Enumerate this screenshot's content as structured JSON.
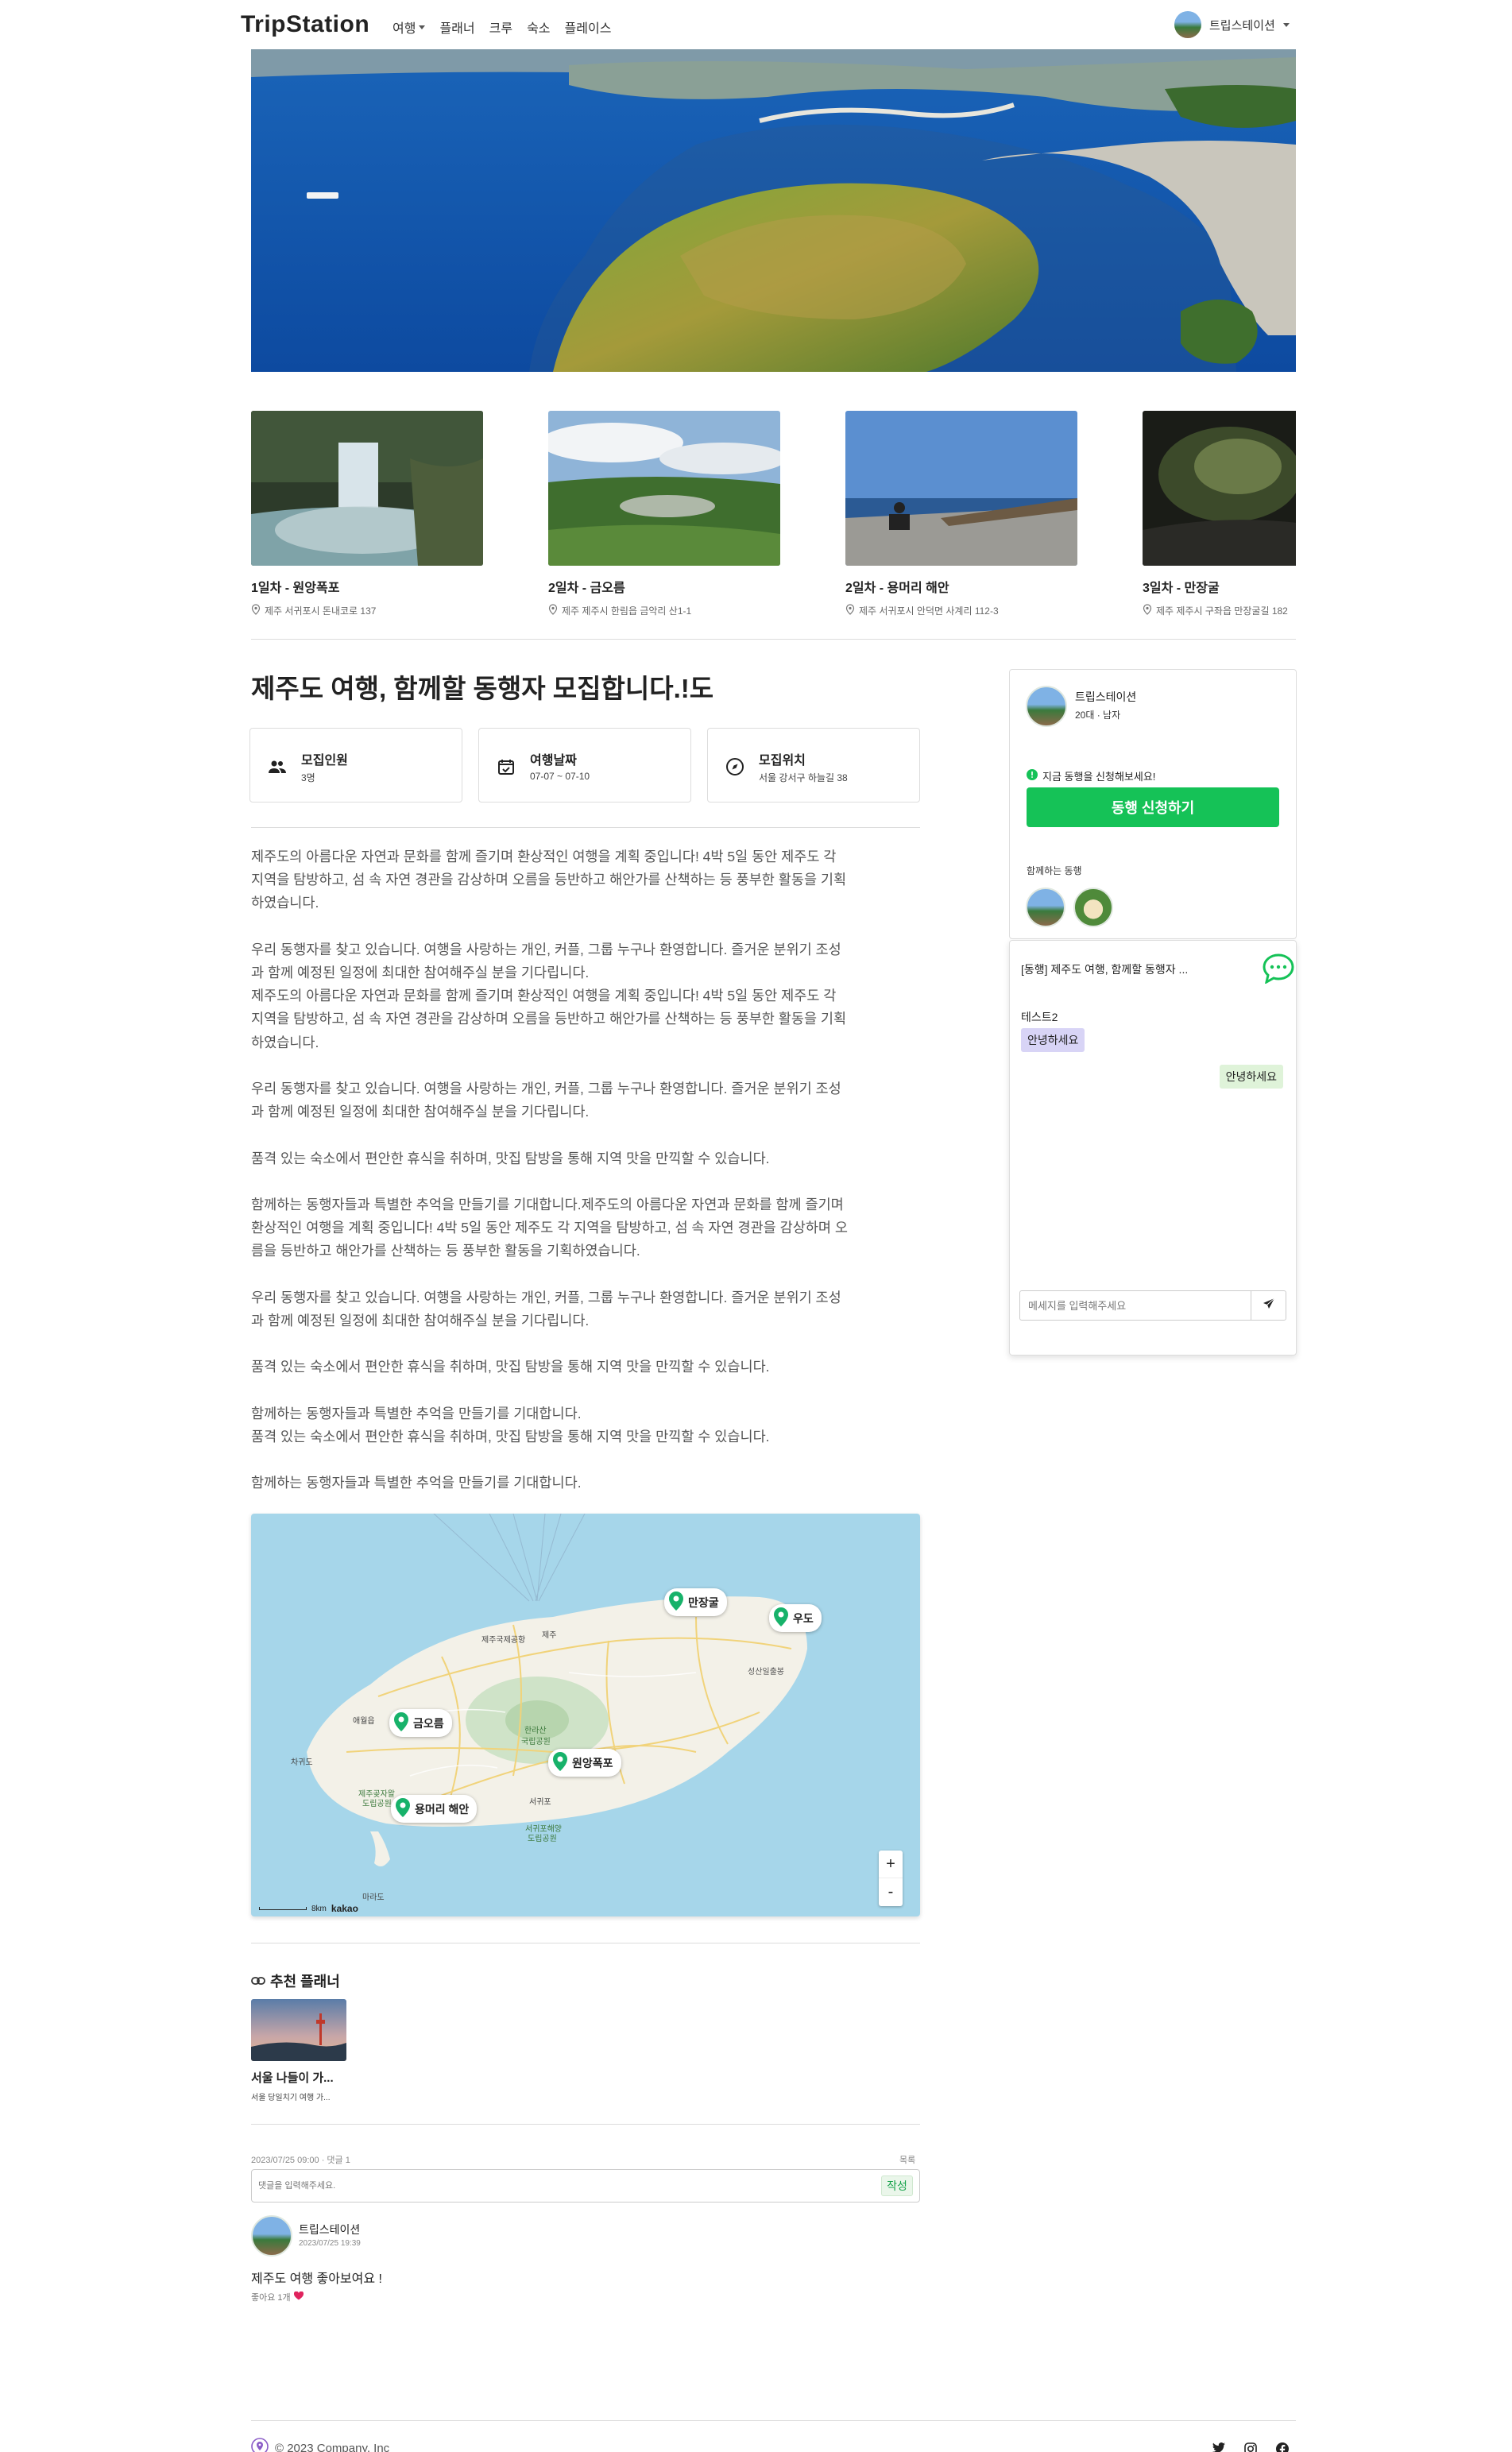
{
  "nav": {
    "logo": "TripStation",
    "menu": [
      {
        "label": "여행",
        "has_dropdown": true
      },
      {
        "label": "플래너",
        "has_dropdown": false
      },
      {
        "label": "크루",
        "has_dropdown": false
      },
      {
        "label": "숙소",
        "has_dropdown": false
      },
      {
        "label": "플레이스",
        "has_dropdown": false
      }
    ],
    "user_name": "트립스테이션"
  },
  "places": [
    {
      "title": "1일차 - 원앙폭포",
      "address": "제주 서귀포시 돈내코로 137"
    },
    {
      "title": "2일차 - 금오름",
      "address": "제주 제주시 한림읍 금악리 산1-1"
    },
    {
      "title": "2일차 - 용머리 해안",
      "address": "제주 서귀포시 안덕면 사계리 112-3"
    },
    {
      "title": "3일차 - 만장굴",
      "address": "제주 제주시 구좌읍 만장굴길 182"
    }
  ],
  "post": {
    "title": "제주도 여행, 함께할 동행자 모집합니다.!도",
    "info": [
      {
        "label": "모집인원",
        "value": "3명",
        "icon": "people-icon"
      },
      {
        "label": "여행날짜",
        "value": "07-07 ~ 07-10",
        "icon": "calendar-check-icon"
      },
      {
        "label": "모집위치",
        "value": "서울 강서구 하늘길 38",
        "icon": "compass-icon"
      }
    ],
    "paragraphs": [
      [
        "제주도의 아름다운 자연과 문화를 함께 즐기며 환상적인 여행을 계획 중입니다! 4박 5일 동안 제주도 각",
        "지역을 탐방하고, 섬 속 자연 경관을 감상하며 오름을 등반하고 해안가를 산책하는 등 풍부한 활동을 기획",
        "하였습니다."
      ],
      [
        "우리 동행자를 찾고 있습니다. 여행을 사랑하는 개인, 커플, 그룹 누구나 환영합니다. 즐거운 분위기 조성",
        "과 함께 예정된 일정에 최대한 참여해주실 분을 기다립니다.",
        "제주도의 아름다운 자연과 문화를 함께 즐기며 환상적인 여행을 계획 중입니다! 4박 5일 동안 제주도 각",
        "지역을 탐방하고, 섬 속 자연 경관을 감상하며 오름을 등반하고 해안가를 산책하는 등 풍부한 활동을 기획",
        "하였습니다."
      ],
      [
        "우리 동행자를 찾고 있습니다. 여행을 사랑하는 개인, 커플, 그룹 누구나 환영합니다. 즐거운 분위기 조성",
        "과 함께 예정된 일정에 최대한 참여해주실 분을 기다립니다."
      ],
      [
        "품격 있는 숙소에서 편안한 휴식을 취하며, 맛집 탐방을 통해 지역 맛을 만끽할 수 있습니다."
      ],
      [
        "함께하는 동행자들과 특별한 추억을 만들기를 기대합니다.제주도의 아름다운 자연과 문화를 함께 즐기며",
        "환상적인 여행을 계획 중입니다! 4박 5일 동안 제주도 각 지역을 탐방하고, 섬 속 자연 경관을 감상하며 오",
        "름을 등반하고 해안가를 산책하는 등 풍부한 활동을 기획하였습니다."
      ],
      [
        "우리 동행자를 찾고 있습니다. 여행을 사랑하는 개인, 커플, 그룹 누구나 환영합니다. 즐거운 분위기 조성",
        "과 함께 예정된 일정에 최대한 참여해주실 분을 기다립니다."
      ],
      [
        "품격 있는 숙소에서 편안한 휴식을 취하며, 맛집 탐방을 통해 지역 맛을 만끽할 수 있습니다."
      ],
      [
        "함께하는 동행자들과 특별한 추억을 만들기를 기대합니다.",
        "품격 있는 숙소에서 편안한 휴식을 취하며, 맛집 탐방을 통해 지역 맛을 만끽할 수 있습니다."
      ],
      [
        "함께하는 동행자들과 특별한 추억을 만들기를 기대합니다."
      ]
    ]
  },
  "map": {
    "markers": [
      "만장굴",
      "우도",
      "금오름",
      "원앙폭포",
      "용머리 해안"
    ],
    "labels": [
      "제주국제공항",
      "제주",
      "성산일출봉",
      "한라산",
      "국립공원",
      "서귀포",
      "서귀포해양",
      "도립공원",
      "제주곶자왈",
      "도립공원",
      "애월읍",
      "차귀도",
      "마라도"
    ],
    "scale_label": "8km",
    "brand": "kakao",
    "zoom_in": "+",
    "zoom_out": "-"
  },
  "recommend": {
    "heading": "추천 플래너",
    "items": [
      {
        "title": "서울 나들이 가...",
        "subtitle": "서울 당일치기 여행 가..."
      }
    ]
  },
  "comments": {
    "meta": "2023/07/25 09:00 · 댓글 1",
    "list_link": "목록",
    "placeholder": "댓글을 입력해주세요.",
    "submit": "작성",
    "items": [
      {
        "author": "트립스테이션",
        "date": "2023/07/25 19:39",
        "text": "제주도 여행 좋아보여요 !",
        "likes": "좋아요 1개"
      }
    ]
  },
  "host": {
    "name": "트립스테이션",
    "meta": "20대 · 남자",
    "notice": "지금 동행을 신청해보세요!",
    "apply_button": "동행 신청하기",
    "companions_label": "함께하는 동행"
  },
  "chat": {
    "title": "[동행] 제주도 여행, 함께할 동행자 ...",
    "messages": [
      {
        "sender": "테스트2",
        "text": "안녕하세요",
        "mine": false
      },
      {
        "sender": "",
        "text": "안녕하세요",
        "mine": true
      }
    ],
    "input_placeholder": "메세지를 입력해주세요"
  },
  "footer": {
    "copyright": "© 2023 Company, Inc",
    "social": [
      "twitter-icon",
      "instagram-icon",
      "facebook-icon"
    ]
  },
  "colors": {
    "accent": "#15c257",
    "chat_mine_bg": "#dff3d9",
    "chat_other_bg": "#d8d4f6"
  }
}
